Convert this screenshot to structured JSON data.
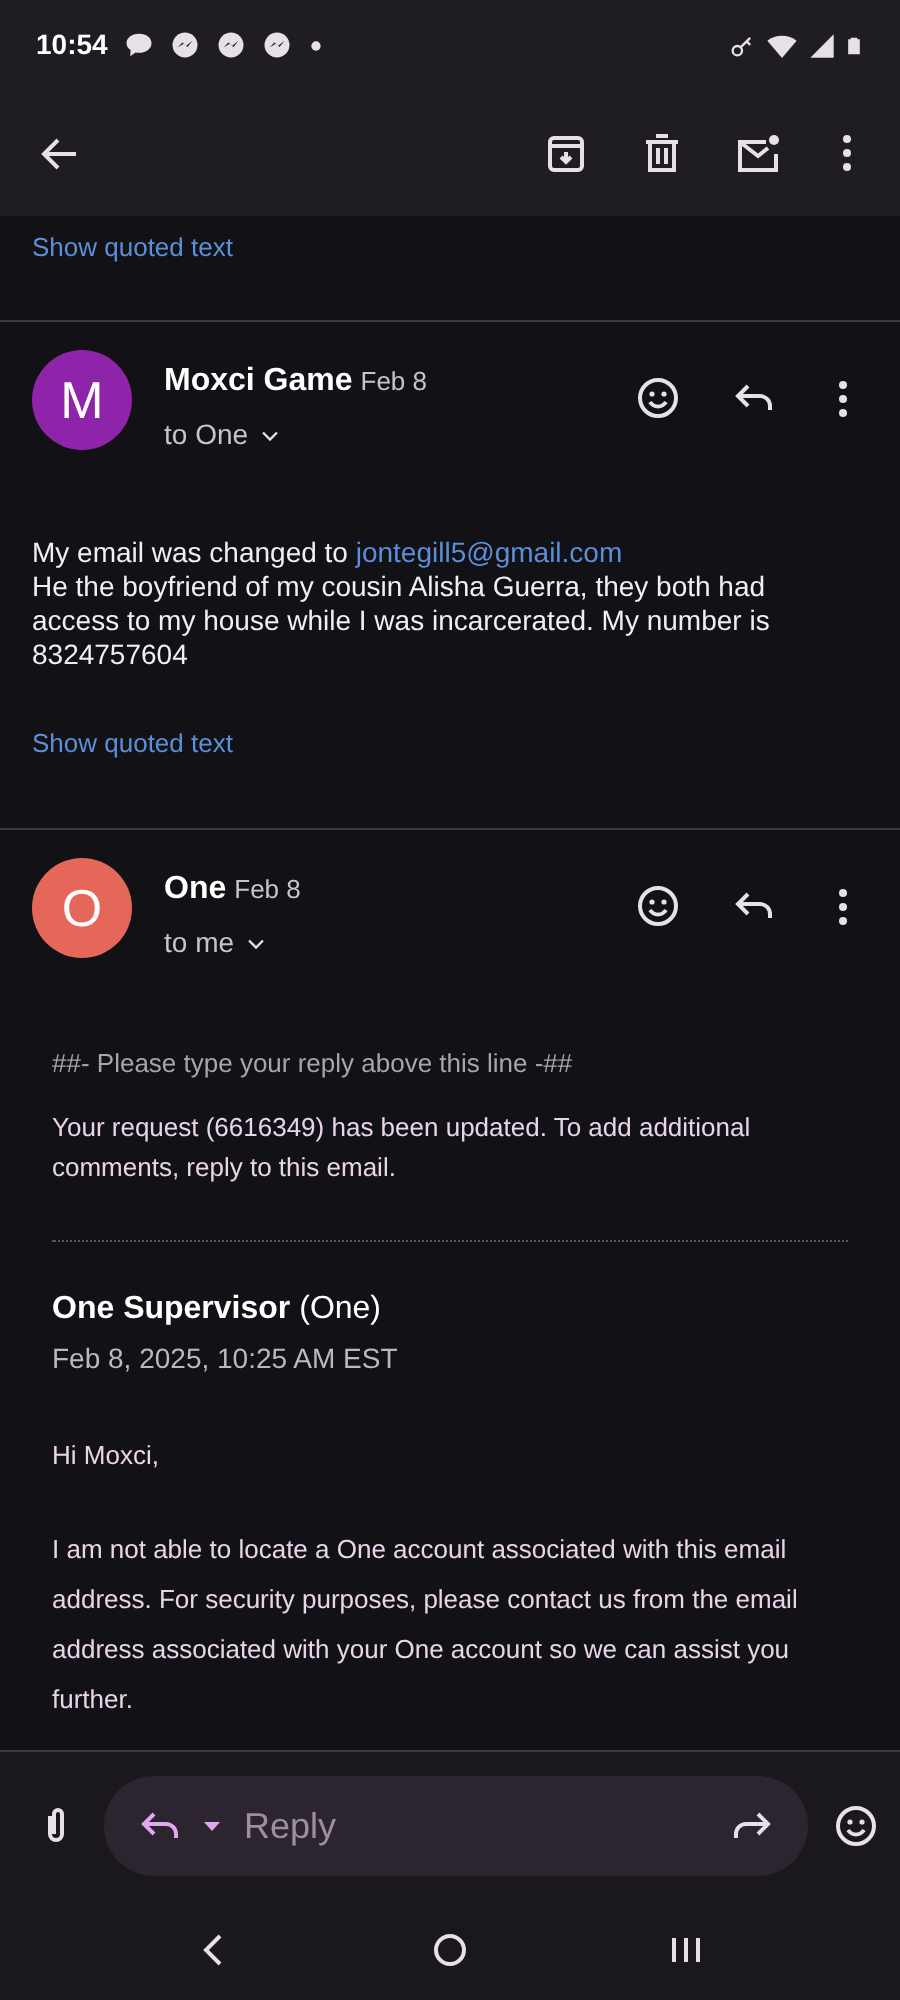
{
  "status_bar": {
    "time": "10:54"
  },
  "top_quoted_link": "Show quoted text",
  "messages": [
    {
      "avatar_letter": "M",
      "color": "#8e24aa",
      "sender": "Moxci Game",
      "date": "Feb 8",
      "recipient": "to One",
      "blocks": [
        {
          "kind": "link_line",
          "text": "My email was changed to",
          "link": "jontegill5@gmail.com"
        },
        {
          "kind": "plain",
          "text": "He the boyfriend of my cousin Alisha Guerra, they both had access to my house while I was incarcerated. My number is 8324757604"
        }
      ],
      "quoted_link": "Show quoted text"
    },
    {
      "avatar_letter": "O",
      "color": "#e5675a",
      "sender": "One",
      "date": "Feb 8",
      "recipient": "to me",
      "blocks": [
        {
          "kind": "note",
          "text": "##- Please type your reply above this line -##"
        },
        {
          "kind": "quoted",
          "text": "Your request (6616349) has been updated. To add additional comments, reply to this email."
        },
        {
          "kind": "rule"
        },
        {
          "kind": "author",
          "name": "One Supervisor",
          "alias": "(One)"
        },
        {
          "kind": "stamp",
          "text": "Feb 8, 2025, 10:25 AM EST"
        },
        {
          "kind": "quoted",
          "text": "Hi Moxci,"
        },
        {
          "kind": "quoted_spaced",
          "text": "I am not able to locate a One account associated with this email address. For security purposes, please contact us from the email address associated with your One account so we can assist you further."
        }
      ]
    }
  ],
  "reply_bar": {
    "placeholder": "Reply"
  }
}
